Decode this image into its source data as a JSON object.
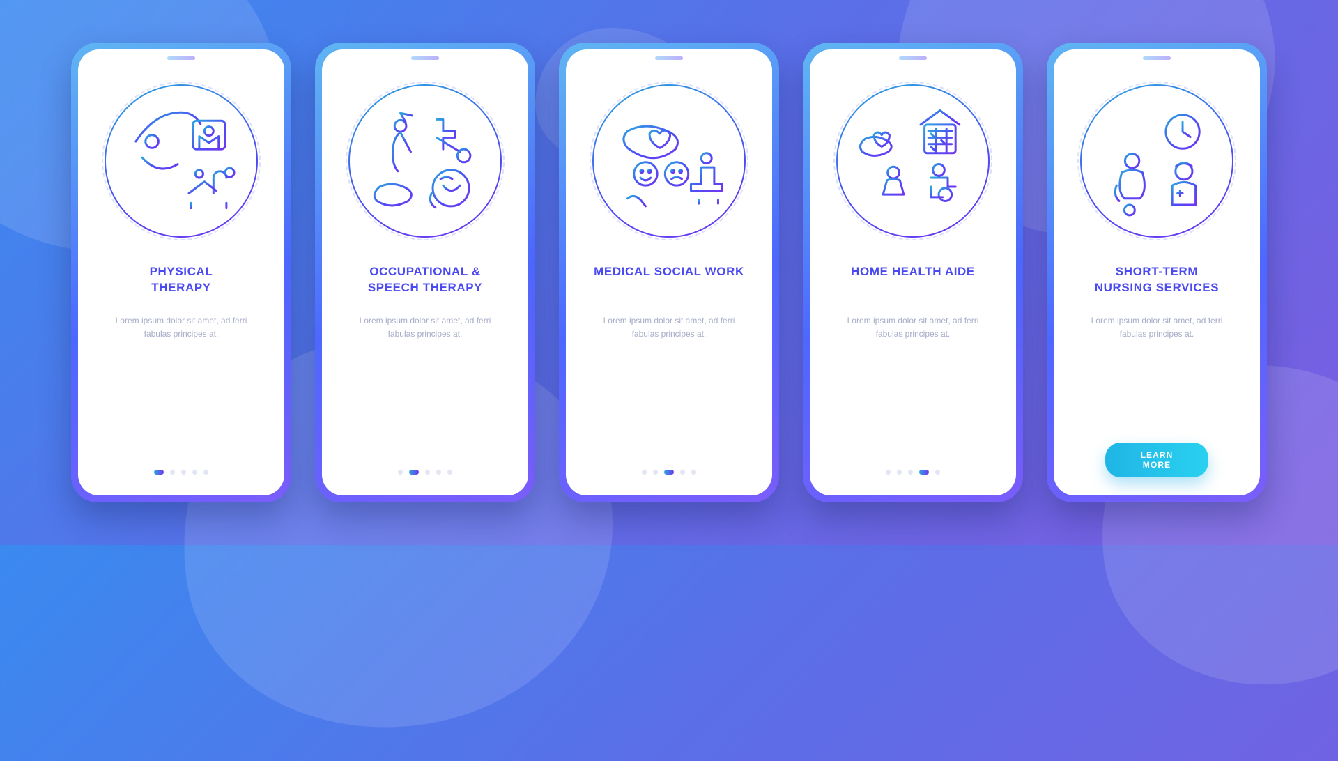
{
  "colors": {
    "accent_start": "#2aa6e0",
    "accent_end": "#7036f0",
    "title": "#4a4af0",
    "body": "#a7adc9"
  },
  "body_text": "Lorem ipsum dolor sit amet, ad ferri fabulas principes at.",
  "cta_label": "LEARN MORE",
  "total_slides": 5,
  "screens": [
    {
      "title": "PHYSICAL\nTHERAPY",
      "icon": "physical-therapy-icon",
      "active_index": 0,
      "has_cta": false
    },
    {
      "title": "OCCUPATIONAL &\nSPEECH THERAPY",
      "icon": "occupational-speech-icon",
      "active_index": 1,
      "has_cta": false
    },
    {
      "title": "MEDICAL SOCIAL WORK",
      "icon": "medical-social-work-icon",
      "active_index": 2,
      "has_cta": false
    },
    {
      "title": "HOME HEALTH AIDE",
      "icon": "home-health-aide-icon",
      "active_index": 3,
      "has_cta": false
    },
    {
      "title": "SHORT-TERM\nNURSING SERVICES",
      "icon": "short-term-nursing-icon",
      "active_index": 4,
      "has_cta": true
    }
  ]
}
